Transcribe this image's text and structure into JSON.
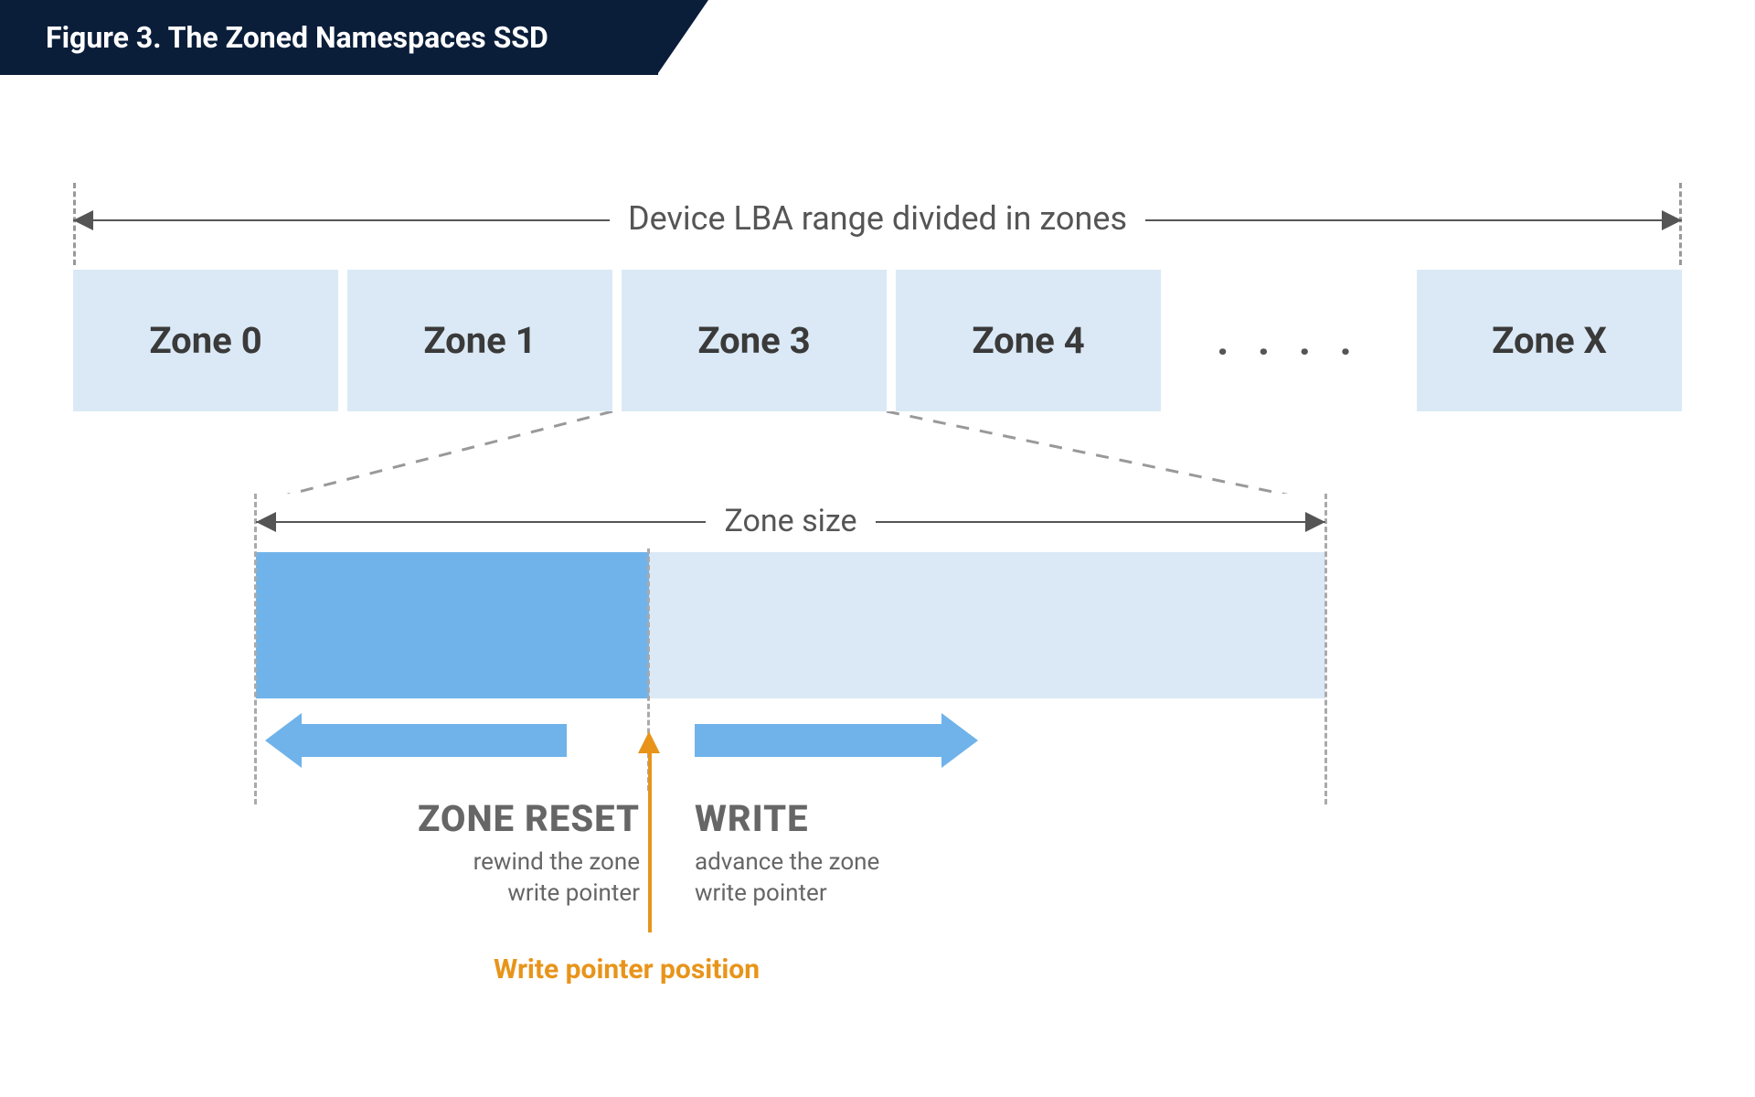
{
  "figure_title": "Figure 3. The Zoned Namespaces SSD",
  "lba_label": "Device LBA range divided in zones",
  "zones": [
    "Zone 0",
    "Zone 1",
    "Zone 3",
    "Zone 4"
  ],
  "dots": ". . . .",
  "zone_x": "Zone X",
  "zone_size_label": "Zone size",
  "zone_reset": {
    "title": "ZONE RESET",
    "desc1": "rewind the zone",
    "desc2": "write pointer"
  },
  "write": {
    "title": "WRITE",
    "desc1": "advance the zone",
    "desc2": "write pointer"
  },
  "pointer_label": "Write pointer position",
  "colors": {
    "title_bg": "#0a1e3a",
    "zone_light": "#dbe9f6",
    "zone_dark": "#6fb3ea",
    "accent_orange": "#e8941a",
    "text_gray": "#555"
  }
}
